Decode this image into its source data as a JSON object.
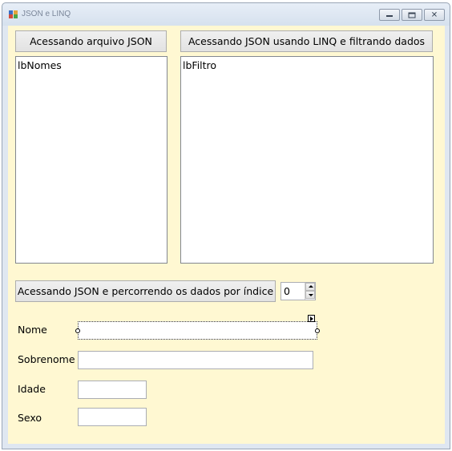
{
  "window": {
    "title": "JSON e LINQ",
    "icon": "winforms-app-icon",
    "caption_buttons": [
      "minimize-icon",
      "restore-icon",
      "close-icon"
    ]
  },
  "buttons": {
    "json_file": "Acessando arquivo JSON",
    "linq_filter": "Acessando JSON usando LINQ e filtrando dados",
    "by_index": "Acessando JSON e percorrendo os dados por índice"
  },
  "listboxes": {
    "names": "lbNomes",
    "filter": "lbFiltro"
  },
  "index_spinner": {
    "value": "0"
  },
  "fields": {
    "nome": {
      "label": "Nome",
      "value": ""
    },
    "sobrenome": {
      "label": "Sobrenome",
      "value": ""
    },
    "idade": {
      "label": "Idade",
      "value": ""
    },
    "sexo": {
      "label": "Sexo",
      "value": ""
    }
  },
  "colors": {
    "client_background": "#fff8d2",
    "title_text": "#7a8699"
  }
}
